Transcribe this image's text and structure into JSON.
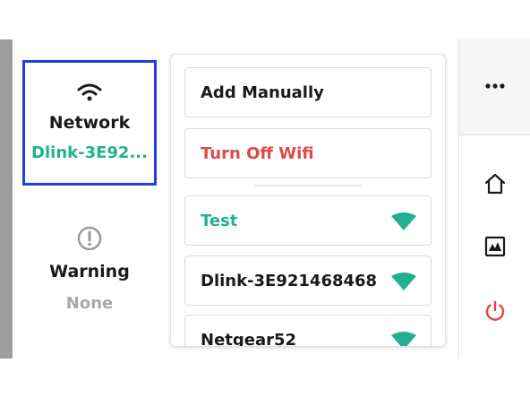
{
  "status": {
    "network_label": "Network",
    "network_value": "Dlink-3E92...",
    "warning_label": "Warning",
    "warning_value": "None"
  },
  "menu": {
    "add_manually": "Add Manually",
    "turn_off_wifi": "Turn Off Wifi"
  },
  "networks": [
    {
      "name": "Test",
      "icon": "wifi-signal-icon"
    },
    {
      "name": "Dlink-3E921468468",
      "icon": "wifi-signal-icon"
    },
    {
      "name": "Netgear52",
      "icon": "wifi-signal-icon"
    }
  ],
  "sidebar": {
    "icons": [
      "more-icon",
      "home-icon",
      "chart-icon",
      "power-icon"
    ]
  },
  "colors": {
    "accent_teal": "#22b18f",
    "danger_red": "#e04848",
    "selection_border": "#1f3fe0",
    "muted_gray": "#a8a8a8"
  }
}
